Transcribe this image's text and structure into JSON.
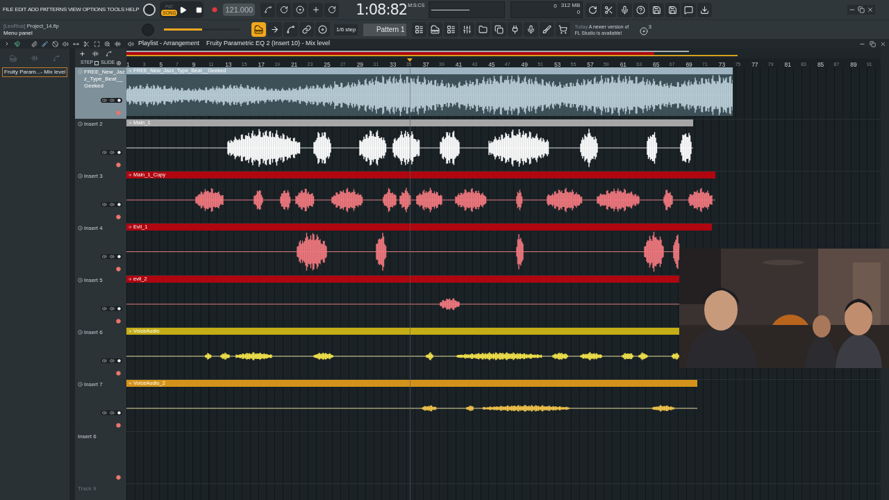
{
  "menu": [
    "FILE",
    "EDIT",
    "ADD",
    "PATTERNS",
    "VIEW",
    "OPTIONS",
    "TOOLS",
    "HELP"
  ],
  "modes": [
    {
      "label": "PAT",
      "selected": false
    },
    {
      "label": "SONG",
      "selected": true
    }
  ],
  "tempo": "121.000",
  "time": {
    "value": "1:08:82",
    "format": "M:S:CS"
  },
  "monitor": {
    "cpu": "0",
    "memory": "312 MB",
    "polyphony": "0"
  },
  "project": {
    "user": "[LeoRios]",
    "file": "Project_14.flp",
    "hint": "Menu panel"
  },
  "master_pitch": {
    "level": 0.5
  },
  "snap": "1/6 step",
  "pattern": "Pattern 1",
  "news": {
    "day": "Today",
    "message": "A newer version of FL Studio is available!",
    "count": "3"
  },
  "breadcrumb": [
    "Playlist - Arrangement",
    "Fruity Parametric EQ 2 (Insert 10) - Mix level"
  ],
  "browser_items": [
    "Fruity Param...- Mix level"
  ],
  "ruler_labels": {
    "step": "STEP",
    "step_checked": false,
    "slide": "SLIDE",
    "slide_on": true
  },
  "bars": [
    "1",
    "3",
    "5",
    "7",
    "9",
    "11",
    "13",
    "15",
    "17",
    "19",
    "21",
    "23",
    "25",
    "27",
    "29",
    "31",
    "33",
    "35",
    "37",
    "39",
    "41",
    "43",
    "45",
    "47",
    "49",
    "51",
    "53",
    "55",
    "57",
    "59",
    "61",
    "63",
    "65",
    "67",
    "69",
    "71",
    "73",
    "75",
    "77",
    "79",
    "81",
    "83",
    "85",
    "87",
    "89",
    "91"
  ],
  "tracks": [
    {
      "name": "FREE_New_Jazz_Type_Beat__Geeked",
      "dimmed": false,
      "clip": {
        "name": "FREE_New_Jazz_Type_Beat__Geeked",
        "color": "#9eb4c0"
      }
    },
    {
      "name": "Insert 2",
      "dimmed": false,
      "clip": {
        "name": "Main_1",
        "color": "#a6a6a6"
      }
    },
    {
      "name": "Insert 3",
      "dimmed": false,
      "clip": {
        "name": "Main_1_Copy",
        "color": "#b00610"
      }
    },
    {
      "name": "Insert 4",
      "dimmed": false,
      "clip": {
        "name": "Evil_1",
        "color": "#b00610"
      }
    },
    {
      "name": "Insert 5",
      "dimmed": false,
      "clip": {
        "name": "evil_2",
        "color": "#b00610"
      }
    },
    {
      "name": "Insert 6",
      "dimmed": false,
      "clip": {
        "name": "VoiceAudio",
        "color": "#c4ad16"
      }
    },
    {
      "name": "Insert 7",
      "dimmed": false,
      "clip": {
        "name": "VoiceAudio_2",
        "color": "#d3931a"
      }
    },
    {
      "name": "Insert 6",
      "dimmed": false
    },
    {
      "name": "Track 9",
      "dimmed": true
    }
  ]
}
